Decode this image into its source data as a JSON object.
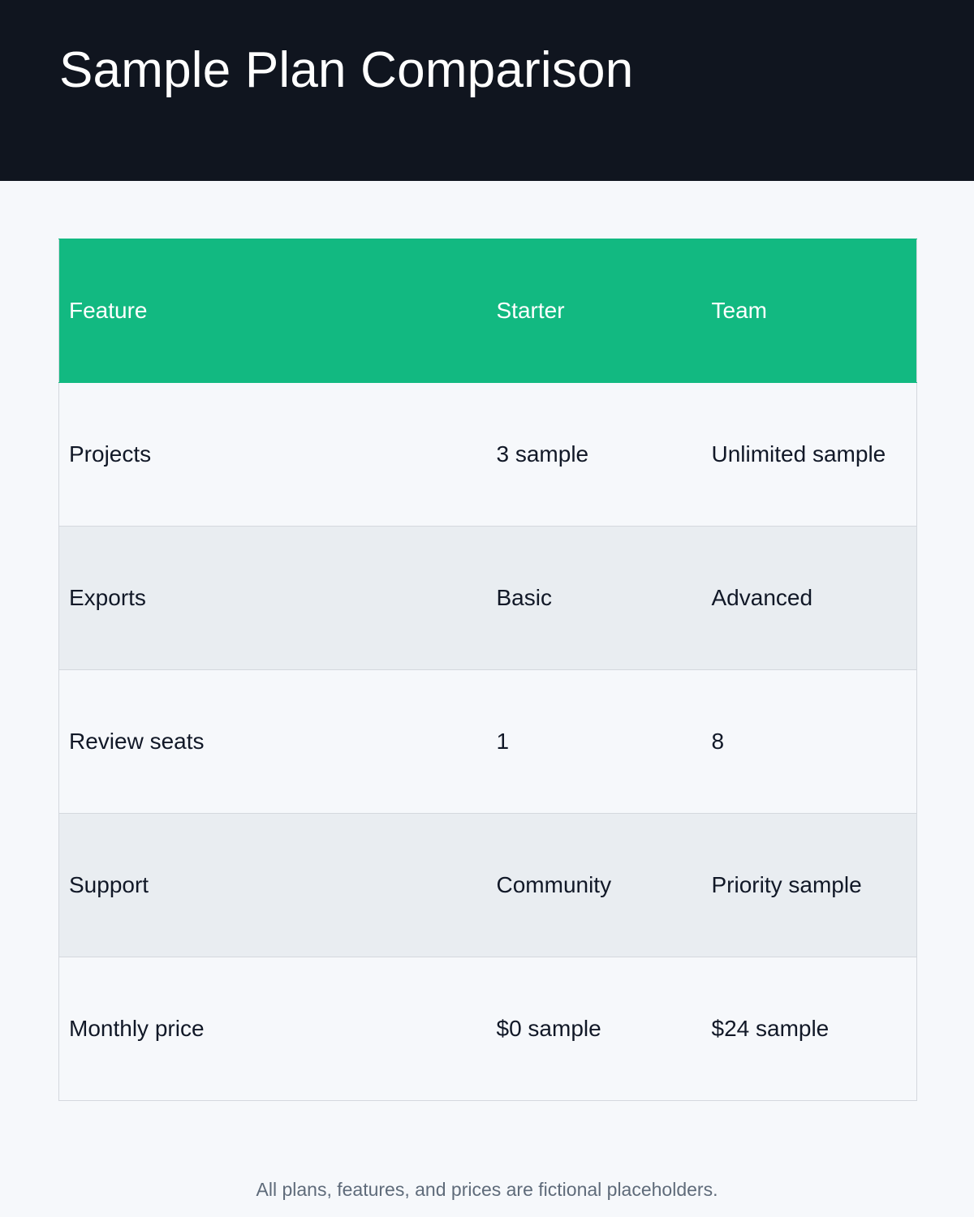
{
  "header": {
    "title": "Sample Plan Comparison"
  },
  "table": {
    "columns": [
      "Feature",
      "Starter",
      "Team"
    ],
    "rows": [
      [
        "Projects",
        "3 sample",
        "Unlimited sample"
      ],
      [
        "Exports",
        "Basic",
        "Advanced"
      ],
      [
        "Review seats",
        "1",
        "8"
      ],
      [
        "Support",
        "Community",
        "Priority sample"
      ],
      [
        "Monthly price",
        "$0 sample",
        "$24 sample"
      ]
    ]
  },
  "footer": {
    "note": "All plans, features, and prices are fictional placeholders."
  },
  "colors": {
    "header_bg": "#10151f",
    "table_header_bg": "#12b981",
    "row_alt_bg": "#e9edf1",
    "page_bg": "#f6f8fb"
  }
}
